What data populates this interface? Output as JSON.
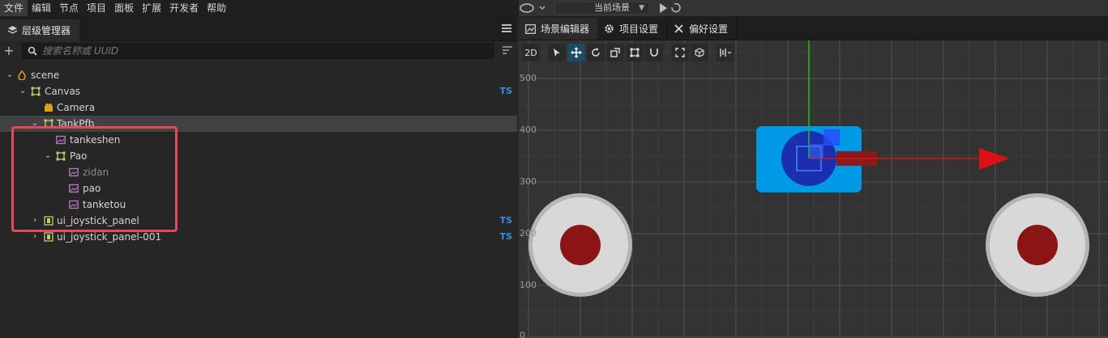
{
  "menu": [
    "文件",
    "编辑",
    "节点",
    "项目",
    "面板",
    "扩展",
    "开发者",
    "帮助"
  ],
  "scene_selector": {
    "value": "当前场景"
  },
  "hierarchy": {
    "tab_label": "层级管理器",
    "search_placeholder": "搜索名称或 UUID",
    "nodes": [
      {
        "label": "scene",
        "ts": ""
      },
      {
        "label": "Canvas",
        "ts": "TS"
      },
      {
        "label": "Camera",
        "ts": ""
      },
      {
        "label": "TankPfb",
        "ts": ""
      },
      {
        "label": "tankeshen",
        "ts": ""
      },
      {
        "label": "Pao",
        "ts": ""
      },
      {
        "label": "zidan",
        "ts": ""
      },
      {
        "label": "pao",
        "ts": ""
      },
      {
        "label": "tanketou",
        "ts": ""
      },
      {
        "label": "ui_joystick_panel",
        "ts": "TS"
      },
      {
        "label": "ui_joystick_panel-001",
        "ts": "TS"
      }
    ]
  },
  "editor_tabs": [
    "场景编辑器",
    "项目设置",
    "偏好设置"
  ],
  "viewport": {
    "mode_label": "2D",
    "y_axis_labels": [
      "500",
      "400",
      "300",
      "200",
      "100",
      "0"
    ],
    "colors": {
      "grid": "#555555",
      "tank_body": "#0099e6",
      "tank_turret": "#1a2fb0",
      "barrel": "#9a1a1a",
      "joystick_outer": "#d0d0d0",
      "joystick_inner": "#8b1515",
      "axis_x": "#dd1111",
      "axis_y": "#22bb22"
    }
  }
}
